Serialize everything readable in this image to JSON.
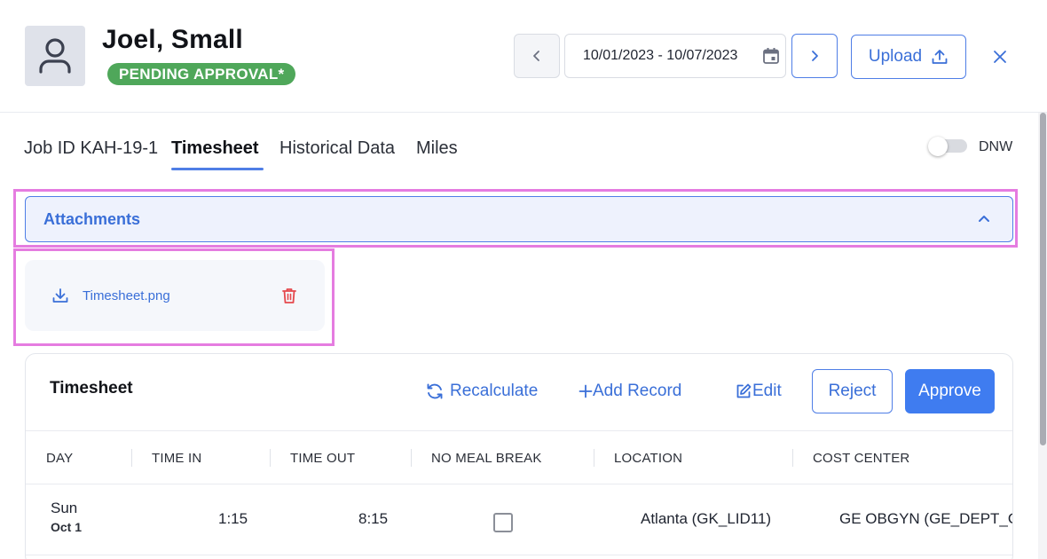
{
  "header": {
    "name": "Joel, Small",
    "status_badge": "PENDING APPROVAL*",
    "date_range": "10/01/2023 - 10/07/2023",
    "upload_label": "Upload"
  },
  "tabs": [
    {
      "label": "Job ID KAH-19-1",
      "active": false
    },
    {
      "label": "Timesheet",
      "active": true
    },
    {
      "label": "Historical Data",
      "active": false
    },
    {
      "label": "Miles",
      "active": false
    }
  ],
  "dnw_toggle": {
    "label": "DNW",
    "on": false
  },
  "attachments": {
    "title": "Attachments",
    "expanded": true,
    "files": [
      {
        "name": "Timesheet.png"
      }
    ]
  },
  "timesheet": {
    "title": "Timesheet",
    "actions": {
      "recalculate": "Recalculate",
      "add_record": "Add Record",
      "edit": "Edit",
      "reject": "Reject",
      "approve": "Approve"
    },
    "columns": [
      "DAY",
      "TIME IN",
      "TIME OUT",
      "NO MEAL BREAK",
      "LOCATION",
      "COST CENTER"
    ],
    "rows": [
      {
        "day": "Sun",
        "date": "Oct 1",
        "time_in": "1:15",
        "time_out": "8:15",
        "no_meal_break": false,
        "location": "Atlanta (GK_LID11)",
        "cost_center": "GE OBGYN (GE_DEPT_ON"
      }
    ]
  },
  "colors": {
    "accent": "#3f7cf0",
    "badge_green": "#4fa75a",
    "delete_red": "#e5484d",
    "highlight": "#e57ce0"
  }
}
